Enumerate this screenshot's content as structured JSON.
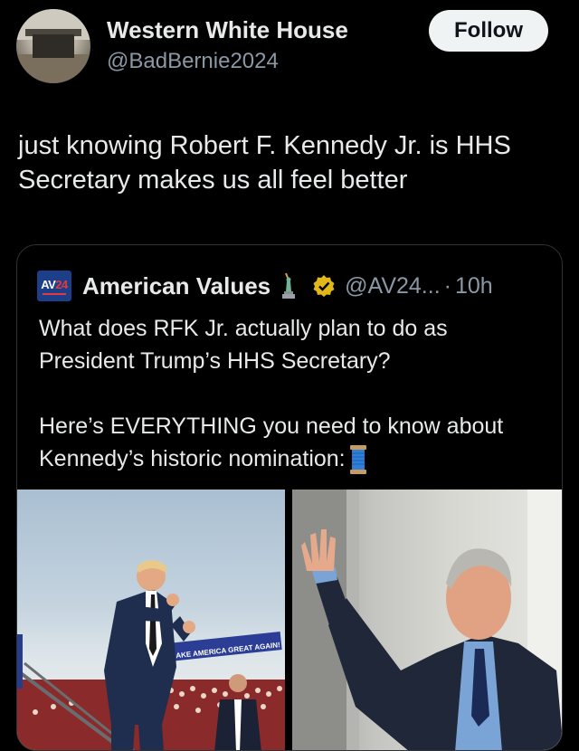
{
  "author": {
    "name": "Western White House",
    "handle": "@BadBernie2024"
  },
  "follow_label": "Follow",
  "tweet_text": "just knowing Robert F. Kennedy Jr. is HHS Secretary makes us all feel better",
  "quoted": {
    "avatar_text_white": "AV",
    "avatar_text_red": "24",
    "name": "American Values",
    "handle": "@AV24...",
    "dot": "·",
    "time": "10h",
    "paragraph1": "What does RFK Jr. actually plan to do as President Trump’s HHS Secretary?",
    "paragraph2": "Here’s EVERYTHING you need to know about Kennedy’s historic nomination:"
  },
  "photos": {
    "left_banner_text": "MAKE AMERICA GREAT AGAIN!"
  },
  "icons": {
    "statue": "statue-of-liberty-icon",
    "verified": "gold-verified-badge-icon",
    "thread": "spool-of-thread-icon"
  },
  "colors": {
    "background": "#000000",
    "follow_bg": "#eff3f4",
    "secondary_text": "#8b98a5",
    "verified_gold": "#e2b719"
  }
}
